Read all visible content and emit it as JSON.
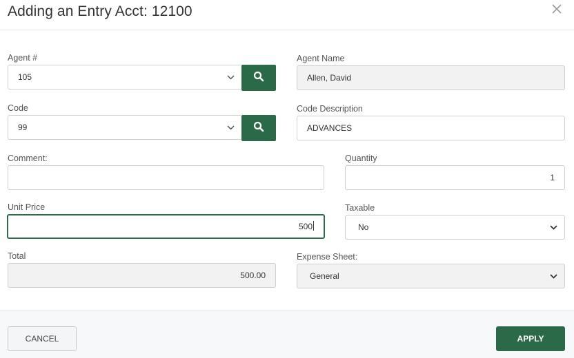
{
  "dialog": {
    "title": "Adding an Entry Acct: 12100"
  },
  "form": {
    "agent_number": {
      "label": "Agent #",
      "value": "105"
    },
    "agent_name": {
      "label": "Agent Name",
      "value": "Allen, David"
    },
    "code": {
      "label": "Code",
      "value": "99"
    },
    "code_description": {
      "label": "Code Description",
      "value": "ADVANCES"
    },
    "comment": {
      "label": "Comment:",
      "value": ""
    },
    "quantity": {
      "label": "Quantity",
      "value": "1"
    },
    "unit_price": {
      "label": "Unit Price",
      "value": "500"
    },
    "taxable": {
      "label": "Taxable",
      "value": "No"
    },
    "total": {
      "label": "Total",
      "value": "500.00"
    },
    "expense_sheet": {
      "label": "Expense Sheet:",
      "value": "General"
    }
  },
  "footer": {
    "cancel_label": "CANCEL",
    "apply_label": "APPLY"
  },
  "colors": {
    "accent": "#2a6a48",
    "readonly_bg": "#f2f2f2",
    "footer_bg": "#f7f8fa"
  }
}
